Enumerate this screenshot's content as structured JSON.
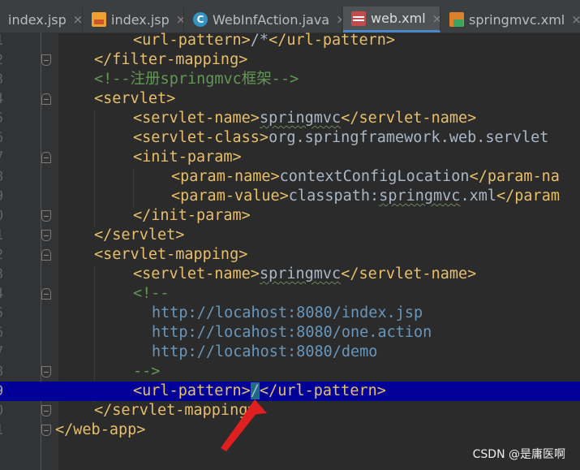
{
  "tabs": [
    {
      "label": "index.jsp",
      "icon": "jsp-file-icon",
      "active": false
    },
    {
      "label": "index.jsp",
      "icon": "jsp-file-icon",
      "active": false
    },
    {
      "label": "WebInfAction.java",
      "icon": "java-class-icon",
      "active": false
    },
    {
      "label": "web.xml",
      "icon": "xml-file-icon",
      "active": true
    },
    {
      "label": "springmvc.xml",
      "icon": "spring-xml-file-icon",
      "active": false
    }
  ],
  "class_icon_letter": "C",
  "close_symbol": "×",
  "line_numbers": [
    "1",
    "2",
    "3",
    "4",
    "5",
    "6",
    "7",
    "8",
    "9",
    "0",
    "1",
    "2",
    "3",
    "4",
    "5",
    "6",
    "7",
    "8",
    "9",
    "0",
    "1"
  ],
  "code": {
    "l1_open": "<url-pattern>",
    "l1_text": "/*",
    "l1_close": "</url-pattern>",
    "l2": "</filter-mapping>",
    "l3": "<!--注册springmvc框架-->",
    "l4": "<servlet>",
    "l5_open": "<servlet-name>",
    "l5_text": "springmvc",
    "l5_close": "</servlet-name>",
    "l6_open": "<servlet-class>",
    "l6_text": "org.springframework.web.servlet",
    "l7": "<init-param>",
    "l8_open": "<param-name>",
    "l8_text": "contextConfigLocation",
    "l8_close": "</param-na",
    "l9_open": "<param-value>",
    "l9_text_a": "classpath:",
    "l9_text_b": "springmvc",
    "l9_text_c": ".xml",
    "l9_close": "</param",
    "l10": "</init-param>",
    "l11": "</servlet>",
    "l12": "<servlet-mapping>",
    "l13_open": "<servlet-name>",
    "l13_text": "springmvc",
    "l13_close": "</servlet-name>",
    "l14": "<!--",
    "l15": "http://locahost:8080/index.jsp",
    "l16": "http://locahost:8080/one.action",
    "l17": "http://locahost:8080/demo",
    "l18": "-->",
    "l19_open": "<url-pattern>",
    "l19_text": "/",
    "l19_close": "</url-pattern>",
    "l20": "</servlet-mapping>",
    "l21": "</web-app>"
  },
  "watermark": "CSDN @是庸医啊",
  "colors": {
    "tag": "#e8bf6a",
    "comment": "#629755",
    "text": "#a9b7c6",
    "highlight_line": "#000099",
    "annotation_arrow": "#e02020"
  }
}
